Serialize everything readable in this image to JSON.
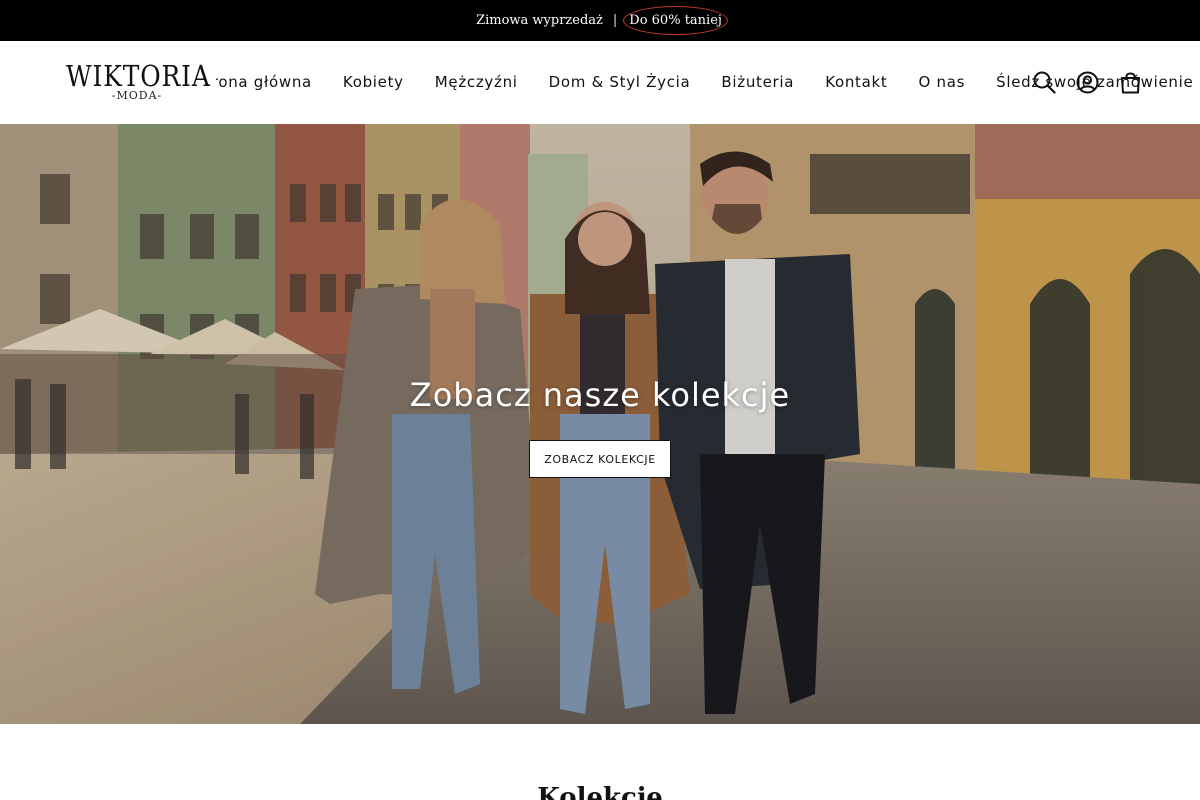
{
  "announcement": {
    "text": "Zimowa wyprzedaż",
    "separator": "|",
    "promo": "Do 60% taniej"
  },
  "header": {
    "logo": {
      "word": "WIKTORIA",
      "sub": "-MODA-"
    },
    "nav": [
      {
        "label": "Strona główna"
      },
      {
        "label": "Kobiety"
      },
      {
        "label": "Mężczyźni"
      },
      {
        "label": "Dom & Styl Życia"
      },
      {
        "label": "Biżuteria"
      },
      {
        "label": "Kontakt"
      },
      {
        "label": "O nas"
      },
      {
        "label": "Śledź swoje zamówienie"
      }
    ],
    "icons": [
      "search-icon",
      "account-icon",
      "cart-icon"
    ]
  },
  "hero": {
    "title": "Zobacz nasze kolekcje",
    "button": "ZOBACZ KOLEKCJE"
  },
  "collections": {
    "title": "Kolekcje"
  },
  "colors": {
    "announcement_bg": "#000000",
    "promo_circle": "#c0392b",
    "text": "#111111"
  }
}
